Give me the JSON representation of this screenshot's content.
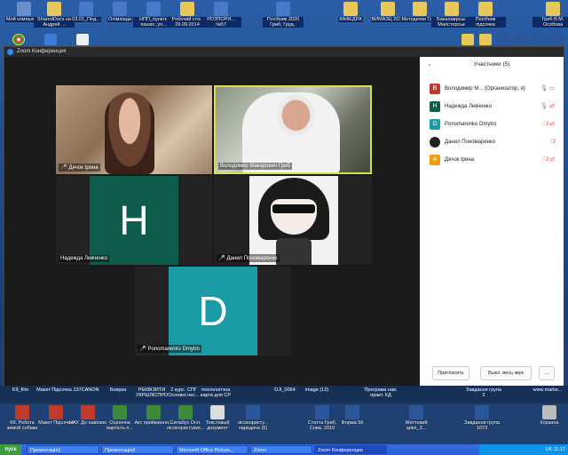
{
  "desktop_icons_top": [
    {
      "label": "Мой компьютер",
      "color": "#6b8fc8"
    },
    {
      "label": "SharedDocs на Андрей ...",
      "color": "#e8c85a"
    },
    {
      "label": "03.01_Пед... ",
      "color": "#4a78c9"
    },
    {
      "label": "Олімпіада",
      "color": "#4a78c9"
    },
    {
      "label": "НПП_пункти пашко..уп...",
      "color": "#4a78c9"
    },
    {
      "label": "Робочий стол 29.09.2014",
      "color": "#e8c85a"
    },
    {
      "label": "РОЗПОРЯ... №57",
      "color": "#4a78c9"
    },
    {
      "label": "Посібник 2020 Гриб, Груд..",
      "color": "#4a78c9"
    },
    {
      "label": "КАФЕДРА",
      "color": "#e8c85a"
    },
    {
      "label": "ВИМАЗЦ 2019",
      "color": "#e8c85a"
    },
    {
      "label": "Методички Гриб",
      "color": "#e8c85a"
    },
    {
      "label": "Бакалаврські Магістерські",
      "color": "#e8c85a"
    },
    {
      "label": "Посібник підсочка",
      "color": "#e8c85a"
    },
    {
      "label": "Гриб В.М. Особова",
      "color": "#e8c85a"
    }
  ],
  "zoom": {
    "title": "Zoom Конференция",
    "tiles": [
      {
        "name": "Дячок Ірина",
        "muted": true
      },
      {
        "name": "Володимир Макарович Гриб",
        "muted": false
      },
      {
        "name": "Надежда Левченко",
        "muted": false,
        "initial": "H",
        "color": "#0e5c4c"
      },
      {
        "name": "Данил Пономаренко",
        "muted": true
      },
      {
        "name": "Ponomarenko Dmytro",
        "muted": true,
        "initial": "D",
        "color": "#1a9aa5"
      }
    ],
    "panel": {
      "title": "Участники (5)",
      "participants": [
        {
          "initial": "В",
          "name": "Володимир М... (Организатор, я)",
          "color": "#c0392b"
        },
        {
          "initial": "H",
          "name": "Надежда Левченко",
          "color": "#0e5c4c"
        },
        {
          "initial": "D",
          "name": "Ponomarenko Dmytro",
          "color": "#1a9aa5"
        },
        {
          "initial": "",
          "name": "Данил Пономаренко",
          "color": "#222222"
        },
        {
          "initial": "A",
          "name": "Дячок Ірина",
          "color": "#f39c12"
        }
      ],
      "invite_label": "Пригласить",
      "mute_all_label": "Выкл. весь звук",
      "more_label": "..."
    }
  },
  "bottom_labels": [
    "K9_film",
    "Макет Підсочка",
    "137CANON",
    "Боярка",
    "РЕКВІЗИТИ УКРШЛІСПРО",
    "2 курс. СПГ Основні нес...",
    "технологічна карта для СР",
    "DJI_0064",
    "image (13)",
    "Програма нав. практ. КД",
    "Завдання група 2",
    "www.marke..."
  ],
  "desktop_icons_bottom": [
    "К9. Робота зимой собаки",
    "Макет Підсочка",
    "НАУ. До навілею",
    "Оціночна вартість п...",
    "Акт приймання...",
    "Силабус Осн. лісокористуват...",
    "Текстовый документ",
    "лісокористу... паредача (5)",
    "Статта Гриб, Сова, 2019",
    "Форма 56",
    "Життєвий цикл_З...",
    "Завдання група 1073",
    "Корзина"
  ],
  "taskbar": {
    "start": "пуск",
    "tasks": [
      "Презентація1",
      "Презентація2",
      "Microsoft Office Picture...",
      "Zoom",
      "Zoom Конференция"
    ],
    "tray": "UK  11:17"
  }
}
